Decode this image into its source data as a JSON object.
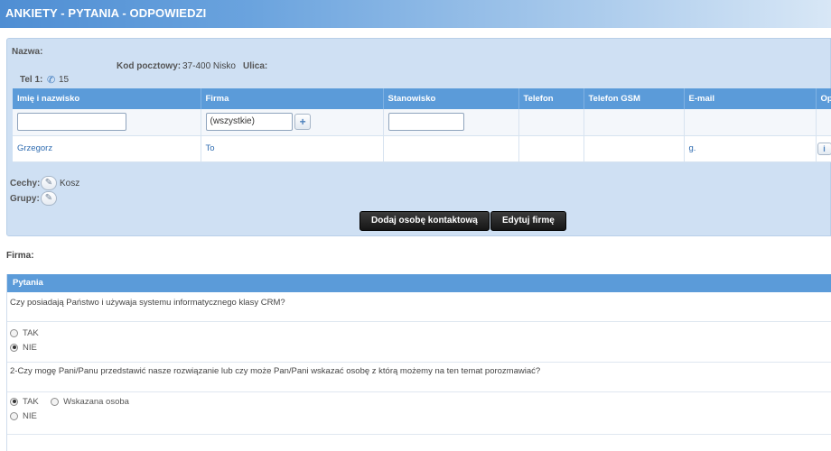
{
  "header": {
    "title": "ANKIETY - PYTANIA - ODPOWIEDZI"
  },
  "company": {
    "name_label": "Nazwa:",
    "postal_label": "Kod pocztowy:",
    "postal_value": "37-400 Nisko",
    "street_label": "Ulica:",
    "phone_label": "Tel 1:",
    "phone_value": "15",
    "traits_label": "Cechy:",
    "traits_value": "Kosz",
    "groups_label": "Grupy:"
  },
  "contacts_table": {
    "columns": [
      "Imię i nazwisko",
      "Firma",
      "Stanowisko",
      "Telefon",
      "Telefon GSM",
      "E-mail",
      "Opcje"
    ],
    "filter": {
      "firma_select": "(wszystkie)",
      "plus": "+"
    },
    "rows": [
      {
        "name": "Grzegorz",
        "firma": "To",
        "stanowisko": "",
        "telefon": "",
        "gsm": "",
        "email": "g.",
        "info": "i"
      }
    ]
  },
  "actions": {
    "add_contact": "Dodaj osobę kontaktową",
    "edit_company": "Edytuj firmę"
  },
  "firm_label": "Firma:",
  "questions": {
    "header": "Pytania",
    "items": [
      {
        "text": "Czy posiadają Państwo i używaja systemu informatycznego klasy CRM?",
        "options": [
          {
            "label": "TAK",
            "checked": false
          },
          {
            "label": "NIE",
            "checked": true
          }
        ]
      },
      {
        "text": "2-Czy mogę Pani/Panu przedstawić nasze rozwiązanie lub czy może Pan/Pani wskazać osobę z którą możemy na ten temat porozmawiać?",
        "options": [
          {
            "label": "TAK",
            "checked": true
          },
          {
            "label": "Wskazana osoba",
            "checked": false
          },
          {
            "label": "NIE",
            "checked": false
          }
        ]
      }
    ]
  }
}
